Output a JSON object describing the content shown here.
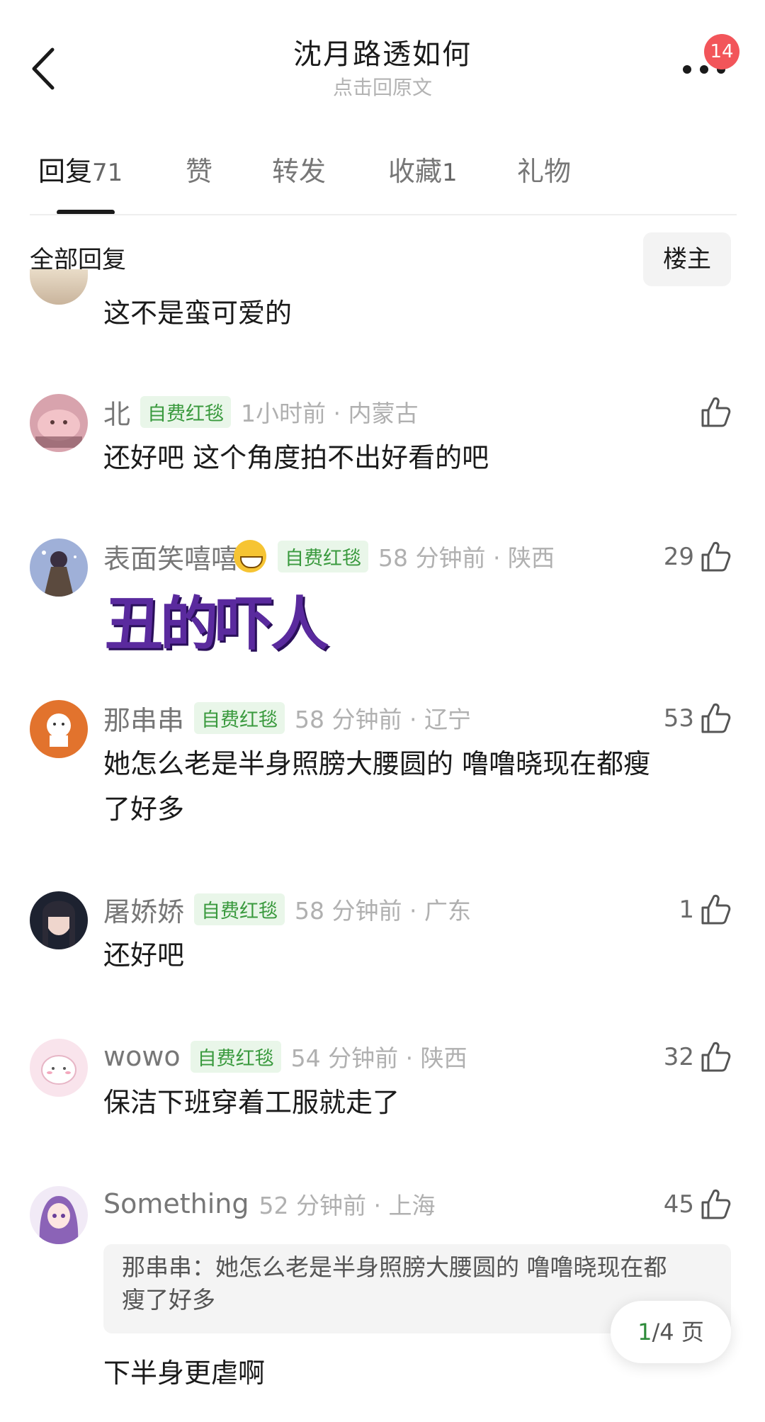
{
  "header": {
    "title": "沈月路透如何",
    "subtitle": "点击回原文",
    "badge": "14"
  },
  "tabs": [
    {
      "label": "回复",
      "count": "71",
      "active": true
    },
    {
      "label": "赞",
      "count": ""
    },
    {
      "label": "转发",
      "count": ""
    },
    {
      "label": "收藏",
      "count": "1"
    },
    {
      "label": "礼物",
      "count": ""
    }
  ],
  "filter": {
    "label": "全部回复",
    "owner_button": "楼主"
  },
  "comments": [
    {
      "text": "这不是蛮可爱的"
    },
    {
      "user": "北",
      "tag": "自费红毯",
      "time": "1小时前 · 内蒙古",
      "likes": "",
      "text": "还好吧 这个角度拍不出好看的吧"
    },
    {
      "user": "表面笑嘻嘻",
      "tag": "自费红毯",
      "time": "58 分钟前 · 陕西",
      "likes": "29",
      "text": "丑的吓人"
    },
    {
      "user": "那串串",
      "tag": "自费红毯",
      "time": "58 分钟前 · 辽宁",
      "likes": "53",
      "text_line1": "她怎么老是半身照膀大腰圆的 噜噜晓现在都瘦",
      "text_line2": "了好多"
    },
    {
      "user": "屠娇娇",
      "tag": "自费红毯",
      "time": "58 分钟前 · 广东",
      "likes": "1",
      "text": "还好吧"
    },
    {
      "user": "wowo",
      "tag": "自费红毯",
      "time": "54 分钟前 · 陕西",
      "likes": "32",
      "text": "保洁下班穿着工服就走了"
    },
    {
      "user": "Something",
      "time": "52 分钟前 · 上海",
      "likes": "45",
      "quote_line1": "那串串：她怎么老是半身照膀大腰圆的 噜噜晓现在都",
      "quote_line2": "瘦了好多",
      "text": "下半身更虐啊"
    }
  ],
  "pager": {
    "current": "1",
    "total": "/4 页"
  },
  "colors": {
    "tag_green": "#3a9a3e",
    "badge_red": "#f2555a"
  }
}
